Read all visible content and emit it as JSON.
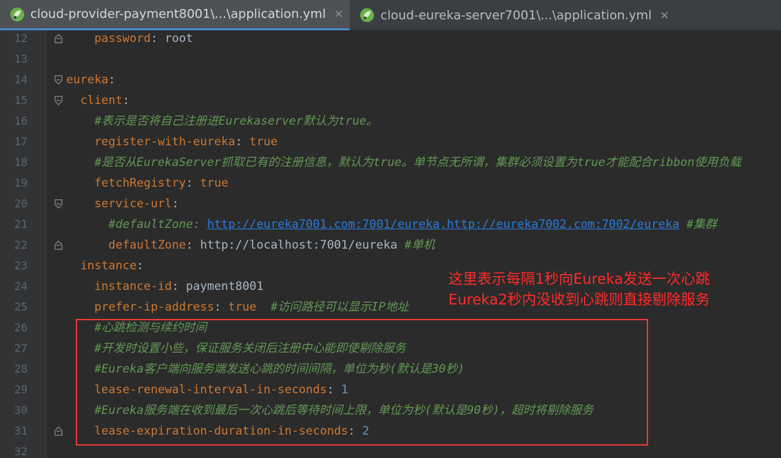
{
  "tabs": [
    {
      "label": "cloud-provider-payment8001\\...\\application.yml",
      "close": "✕",
      "icon": "spring-leaf-icon"
    },
    {
      "label": "cloud-eureka-server7001\\...\\application.yml",
      "close": "✕",
      "icon": "spring-leaf-icon"
    }
  ],
  "lines": [
    {
      "n": "12",
      "parts": [
        {
          "t": "    password",
          "c": "key"
        },
        {
          "t": ": root",
          "c": "val"
        }
      ]
    },
    {
      "n": "13",
      "parts": []
    },
    {
      "n": "14",
      "parts": [
        {
          "t": "eureka",
          "c": "key"
        },
        {
          "t": ":",
          "c": "val"
        }
      ]
    },
    {
      "n": "15",
      "parts": [
        {
          "t": "  client",
          "c": "key"
        },
        {
          "t": ":",
          "c": "val"
        }
      ]
    },
    {
      "n": "16",
      "parts": [
        {
          "t": "    #表示是否将自己注册进Eurekaserver默认为true。",
          "c": "cmt"
        }
      ]
    },
    {
      "n": "17",
      "parts": [
        {
          "t": "    register-with-eureka",
          "c": "key"
        },
        {
          "t": ": ",
          "c": "val"
        },
        {
          "t": "true",
          "c": "key"
        }
      ]
    },
    {
      "n": "18",
      "parts": [
        {
          "t": "    #是否从EurekaServer抓取已有的注册信息，默认为true。单节点无所谓，集群必须设置为true才能配合ribbon使用负载",
          "c": "cmt"
        }
      ]
    },
    {
      "n": "19",
      "parts": [
        {
          "t": "    fetchRegistry",
          "c": "key"
        },
        {
          "t": ": ",
          "c": "val"
        },
        {
          "t": "true",
          "c": "key"
        }
      ]
    },
    {
      "n": "20",
      "parts": [
        {
          "t": "    service-url",
          "c": "key"
        },
        {
          "t": ":",
          "c": "val"
        }
      ]
    },
    {
      "n": "21",
      "parts": [
        {
          "t": "      #defaultZone: ",
          "c": "cmt"
        },
        {
          "t": "http://eureka7001.com:7001/eureka,http://eureka7002.com:7002/eureka",
          "c": "url"
        },
        {
          "t": " #集群",
          "c": "cmt"
        }
      ]
    },
    {
      "n": "22",
      "parts": [
        {
          "t": "      defaultZone",
          "c": "key"
        },
        {
          "t": ": http://localhost:7001/eureka ",
          "c": "val"
        },
        {
          "t": "#单机",
          "c": "cmt"
        }
      ]
    },
    {
      "n": "23",
      "parts": [
        {
          "t": "  instance",
          "c": "key"
        },
        {
          "t": ":",
          "c": "val"
        }
      ]
    },
    {
      "n": "24",
      "parts": [
        {
          "t": "    instance-id",
          "c": "key"
        },
        {
          "t": ": payment8001",
          "c": "val"
        }
      ]
    },
    {
      "n": "25",
      "parts": [
        {
          "t": "    prefer-ip-address",
          "c": "key"
        },
        {
          "t": ": ",
          "c": "val"
        },
        {
          "t": "true",
          "c": "key"
        },
        {
          "t": "  #访问路径可以显示IP地址",
          "c": "cmt"
        }
      ]
    },
    {
      "n": "26",
      "parts": [
        {
          "t": "    #心跳检测与续约时间",
          "c": "cmt"
        }
      ]
    },
    {
      "n": "27",
      "parts": [
        {
          "t": "    #开发时设置小些，保证服务关闭后注册中心能即使剔除服务",
          "c": "cmt"
        }
      ]
    },
    {
      "n": "28",
      "parts": [
        {
          "t": "    #Eureka客户端向服务端发送心跳的时间间隔，单位为秒(默认是30秒)",
          "c": "cmt"
        }
      ]
    },
    {
      "n": "29",
      "parts": [
        {
          "t": "    lease-renewal-interval-in-seconds",
          "c": "key"
        },
        {
          "t": ": ",
          "c": "val"
        },
        {
          "t": "1",
          "c": "num"
        }
      ]
    },
    {
      "n": "30",
      "parts": [
        {
          "t": "    #Eureka服务端在收到最后一次心跳后等待时间上限，单位为秒(默认是90秒)，超时将剔除服务",
          "c": "cmt"
        }
      ]
    },
    {
      "n": "31",
      "parts": [
        {
          "t": "    lease-expiration-duration-in-seconds",
          "c": "key"
        },
        {
          "t": ": ",
          "c": "val"
        },
        {
          "t": "2",
          "c": "num"
        }
      ]
    },
    {
      "n": "32",
      "parts": []
    }
  ],
  "annotation": {
    "line1": "这里表示每隔1秒向Eureka发送一次心跳",
    "line2": "Eureka2秒内没收到心跳则直接剔除服务",
    "color": "#ff2a2a"
  },
  "colors": {
    "key": "#cc7832",
    "comment": "#629755",
    "number": "#6897bb",
    "url": "#287bde",
    "background": "#2b2b2b"
  }
}
